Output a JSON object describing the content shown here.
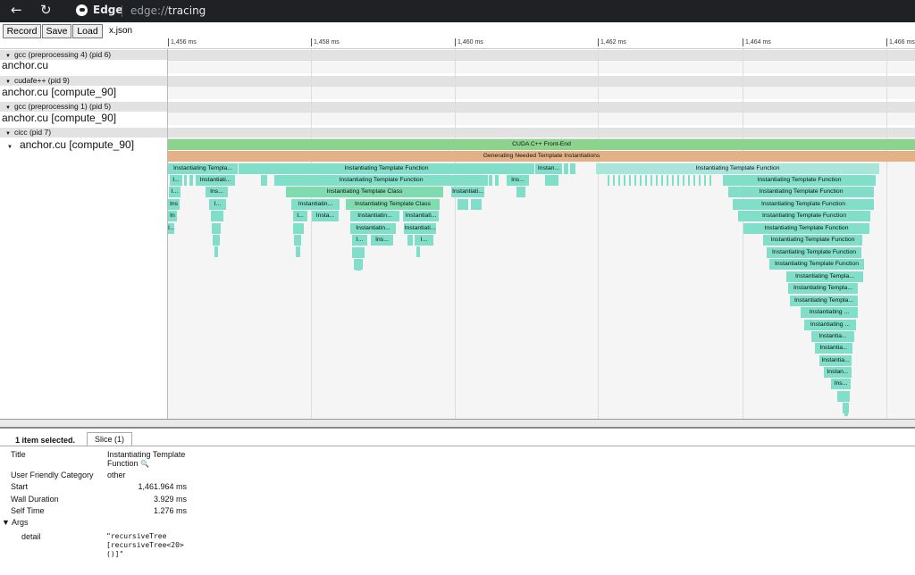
{
  "browser": {
    "edge_label": "Edge",
    "url_scheme": "edge://",
    "url_path": "tracing"
  },
  "toolbar": {
    "record_label": "Record",
    "save_label": "Save",
    "load_label": "Load",
    "file_name": "x.json"
  },
  "ruler": {
    "ticks": [
      "1,456 ms",
      "1,458 ms",
      "1,460 ms",
      "1,462 ms",
      "1,464 ms",
      "1,466 ms"
    ]
  },
  "processes": [
    {
      "header": "gcc (preprocessing 4) (pid 6)",
      "thread": "anchor.cu"
    },
    {
      "header": "cudafe++ (pid 9)",
      "thread": "anchor.cu [compute_90]"
    },
    {
      "header": "gcc (preprocessing 1) (pid 5)",
      "thread": "anchor.cu [compute_90]"
    },
    {
      "header": "cicc (pid 7)",
      "thread": "anchor.cu [compute_90]"
    }
  ],
  "slices": {
    "frontend": "CUDA C++ Front-End",
    "generating": "Generating Needed Template Instantiations",
    "itp_short": "Instantiating Templa...",
    "itf": "Instantiating Template Function",
    "itc": "Instantiating Template Class",
    "inst_dots": "Instan...",
    "instantiatin": "Instantiatin...",
    "instantiati": "Instantiati...",
    "instantia": "Instantia...",
    "instantiat_sp": "Instantiating ...",
    "ins": "Ins...",
    "insta": "Insta...",
    "instantiati_b": "Instantiati...",
    "i": "I...",
    "ins_b": "Ins",
    "in": "In",
    "ins2": "Ins...",
    "instan": "Instan...",
    "instantiatin_b": "Instantiatin...",
    "instantiating_t": "Instantiating Templa..."
  },
  "details": {
    "selected_text": "1 item selected.",
    "tab_label": "Slice (1)",
    "title_label": "Title",
    "title_value": "Instantiating Template Function",
    "category_label": "User Friendly Category",
    "category_value": "other",
    "start_label": "Start",
    "start_value": "1,461.964 ms",
    "wall_label": "Wall Duration",
    "wall_value": "3.929 ms",
    "self_label": "Self Time",
    "self_value": "1.276 ms",
    "args_label": "Args",
    "detail_label": "detail",
    "detail_value": "\"recursiveTree\n[recursiveTree<20>\n()]\""
  },
  "colors": {
    "function_teal": "#80dec9",
    "class_green": "#7fdcae",
    "generating_orange": "#e3b185",
    "frontend_green": "#8cd48e"
  }
}
